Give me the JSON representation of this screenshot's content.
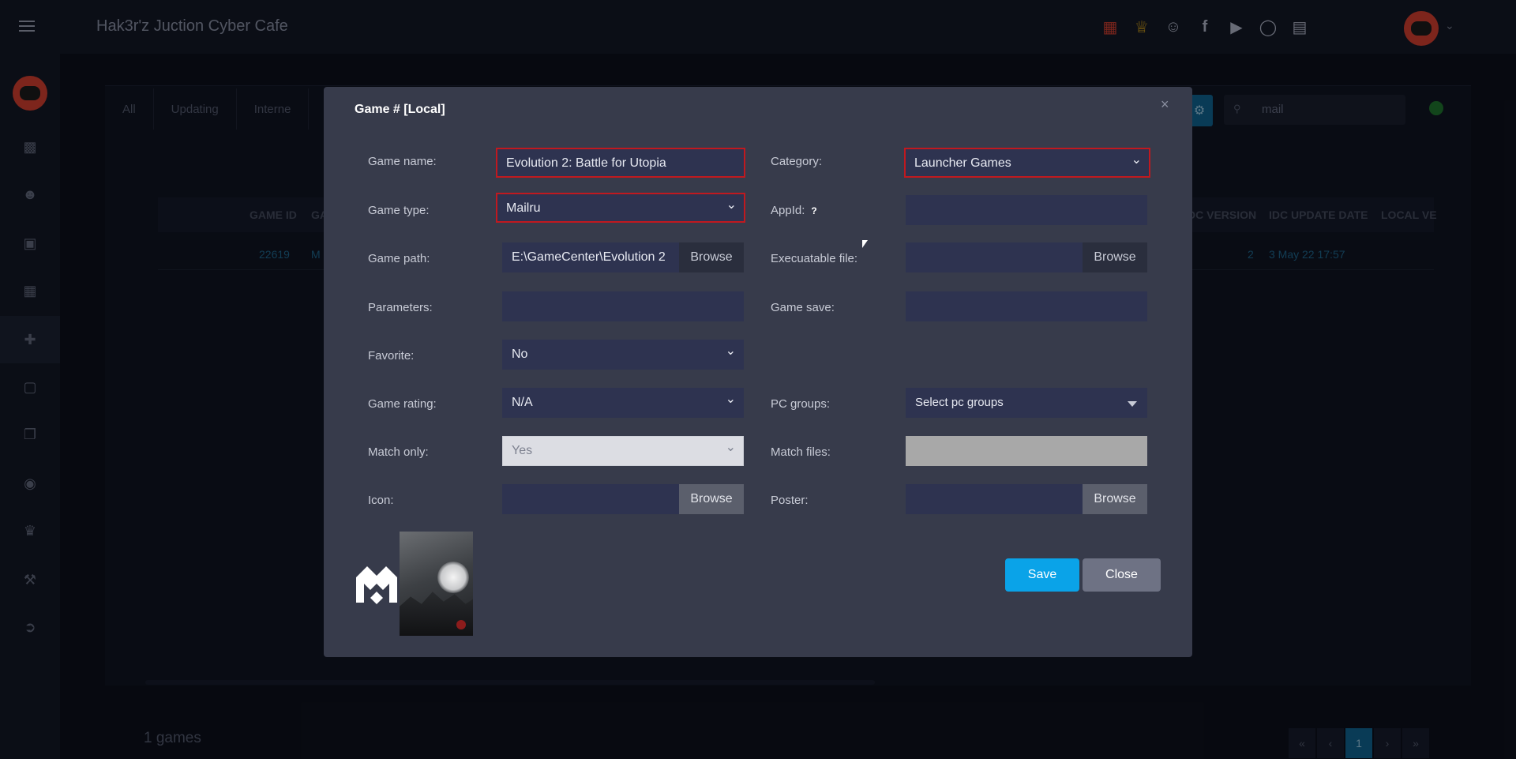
{
  "header": {
    "title": "Hak3r'z Juction Cyber Cafe",
    "icons": [
      "gift-icon",
      "trophy-icon",
      "discord-icon",
      "facebook-icon",
      "youtube-icon",
      "globe-icon",
      "book-icon"
    ]
  },
  "sidebar": {
    "items": [
      "monitor-icon",
      "users-icon",
      "cart-icon",
      "windows-icon",
      "gamepad-icon",
      "calendar-icon",
      "copy-icon",
      "badge-icon",
      "crown-icon",
      "tools-icon",
      "logout-icon"
    ],
    "active_index": 4
  },
  "background": {
    "tabs": [
      "All",
      "Updating",
      "Interne"
    ],
    "search_value": "mail",
    "table_headers": [
      "GAME ID",
      "GA",
      "DC VERSION",
      "IDC UPDATE DATE",
      "LOCAL VE"
    ],
    "row": {
      "game_id": "22619",
      "name_fragment": "M",
      "version": "2",
      "update_date": "3 May 22 17:57"
    },
    "games_count": "1 games",
    "pager": [
      "«",
      "‹",
      "1",
      "›",
      "»"
    ]
  },
  "modal": {
    "title": "Game # [Local]",
    "close_symbol": "×",
    "fields": {
      "game_name": {
        "label": "Game name:",
        "value": "Evolution 2: Battle for Utopia"
      },
      "category": {
        "label": "Category:",
        "value": "Launcher Games"
      },
      "game_type": {
        "label": "Game type:",
        "value": "Mailru"
      },
      "appid": {
        "label": "AppId:",
        "value": "",
        "help": "?"
      },
      "game_path": {
        "label": "Game path:",
        "value": "E:\\GameCenter\\Evolution 2",
        "button": "Browse"
      },
      "executable": {
        "label": "Execuatable file:",
        "value": "",
        "button": "Browse"
      },
      "parameters": {
        "label": "Parameters:",
        "value": ""
      },
      "game_save": {
        "label": "Game save:",
        "value": ""
      },
      "favorite": {
        "label": "Favorite:",
        "value": "No"
      },
      "game_rating": {
        "label": "Game rating:",
        "value": "N/A"
      },
      "pc_groups": {
        "label": "PC groups:",
        "value": "Select pc groups"
      },
      "match_only": {
        "label": "Match only:",
        "value": "Yes"
      },
      "match_files": {
        "label": "Match files:",
        "value": ""
      },
      "icon": {
        "label": "Icon:",
        "value": "",
        "button": "Browse"
      },
      "poster": {
        "label": "Poster:",
        "value": "",
        "button": "Browse"
      }
    },
    "buttons": {
      "save": "Save",
      "close": "Close"
    }
  },
  "colors": {
    "accent": "#0aa3e8",
    "highlight_border": "#c0191f",
    "modal_bg": "#373b4b",
    "field_bg": "#2e3350"
  }
}
